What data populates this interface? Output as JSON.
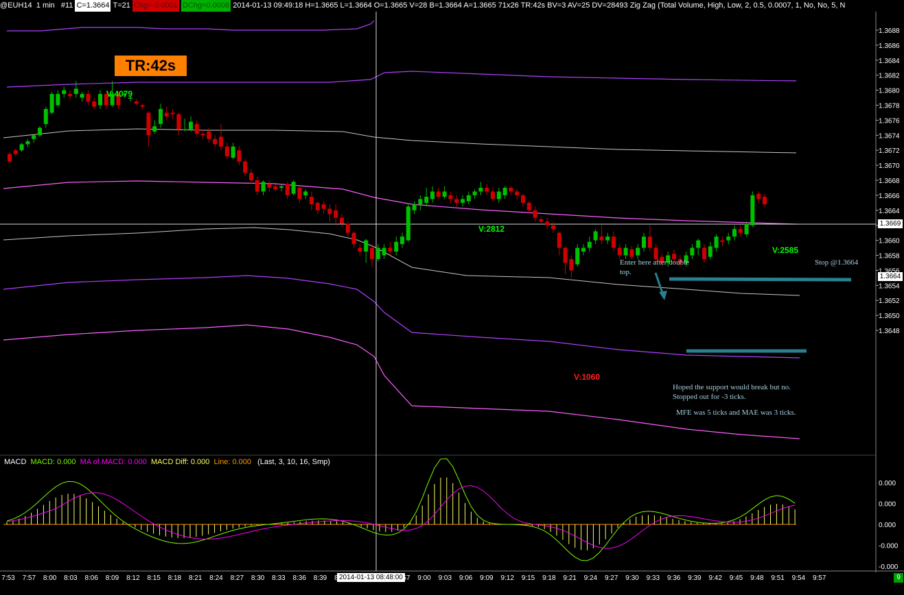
{
  "header": {
    "symbol": "@EUH14",
    "interval": "1 min",
    "bar_num": "#11",
    "close": "C=1.3664",
    "ticks": "T=21",
    "chg": "Chg=-0.0001",
    "dchg": "DChg=0.0008",
    "info": "2014-01-13 09:49:18 H=1.3665 L=1.3664 O=1.3665 V=28 B=1.3664 A=1.3665 71x26 TR:42s BV=3 AV=25 DV=28493",
    "study": "Zig Zag   (Total Volume, High, Low, 2, 0.5, 0.0007, 1, No, No, 5, N"
  },
  "tr_label": "TR:42s",
  "price_axis": [
    "1.3688",
    "1.3686",
    "1.3684",
    "1.3682",
    "1.3680",
    "1.3678",
    "1.3676",
    "1.3674",
    "1.3672",
    "1.3670",
    "1.3668",
    "1.3666",
    "1.3664",
    "1.3662",
    "1.3660",
    "1.3658",
    "1.3656",
    "1.3654",
    "1.3652",
    "1.3650",
    "1.3648"
  ],
  "price_tags": {
    "crosshair": "1.3669",
    "last": "1.3664"
  },
  "macd_axis": [
    "0.000",
    "0.000",
    "0.000",
    "-0.000",
    "-0.000"
  ],
  "time_axis": [
    "7:53",
    "7:57",
    "8:00",
    "8:03",
    "8:06",
    "8:09",
    "8:12",
    "8:15",
    "8:18",
    "8:21",
    "8:24",
    "8:27",
    "8:30",
    "8:33",
    "8:36",
    "8:39",
    "8:42",
    "8:4",
    "54",
    "8:57",
    "9:00",
    "9:03",
    "9:06",
    "9:09",
    "9:12",
    "9:15",
    "9:18",
    "9:21",
    "9:24",
    "9:27",
    "9:30",
    "9:33",
    "9:36",
    "9:39",
    "9:42",
    "9:45",
    "9:48",
    "9:51",
    "9:54",
    "9:57"
  ],
  "crosshair_time": "2014-01-13  08:48:00",
  "volume_labels": [
    {
      "text": "V:4079",
      "color": "#00ff00"
    },
    {
      "text": "V:2812",
      "color": "#00ff00"
    },
    {
      "text": "V:1060",
      "color": "#ff2020"
    },
    {
      "text": "V:2585",
      "color": "#00ff00"
    }
  ],
  "annotations": {
    "enter": [
      "Enter here after double",
      "top."
    ],
    "stop": "Stop @1.3664",
    "support": [
      "Hoped the support would break but no.",
      "Stopped out for -3 ticks."
    ],
    "mfe": "MFE was 5 ticks and MAE was 3 ticks."
  },
  "macd_legend": {
    "name": "MACD",
    "macd": "MACD: 0.000",
    "ma": "MA of MACD: 0.000",
    "diff": "MACD Diff: 0.000",
    "line": "Line: 0.000",
    "params": "(Last, 3, 10, 16, Smp)"
  },
  "corner_badge": "9",
  "colors": {
    "up": "#00c000",
    "down": "#d00000",
    "band_purple": "#b040ff",
    "band_magenta": "#ff60ff",
    "macd": "#7cfc00",
    "ma_macd": "#ff00ff",
    "diff": "#ffff66",
    "annotation_line": "#2a8090"
  }
}
